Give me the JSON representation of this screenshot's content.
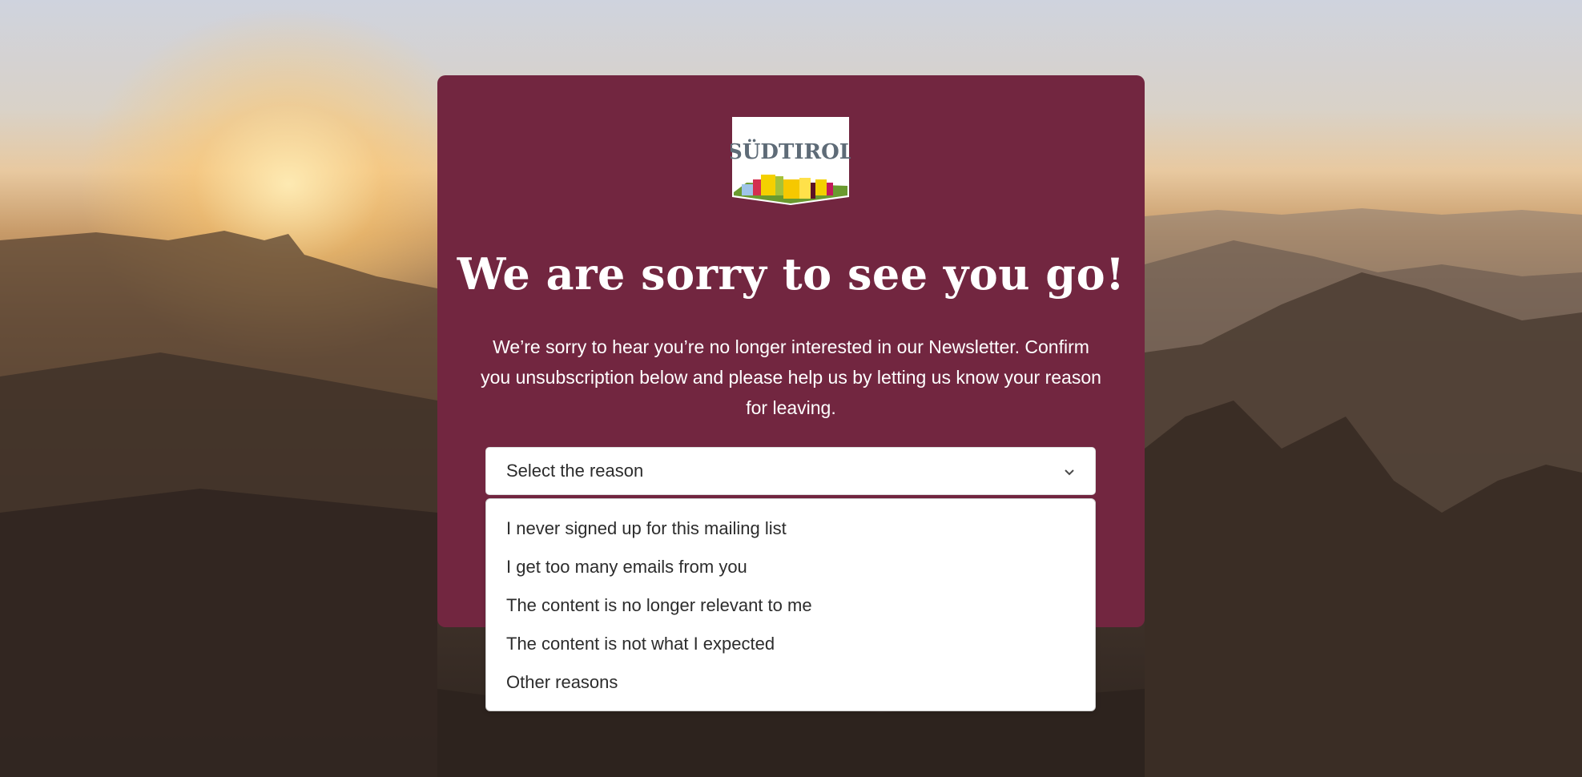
{
  "brand": {
    "logo_text": "SÜDTIROL"
  },
  "title": "We are sorry to see you go!",
  "intro": "We’re sorry to hear you’re no longer interested in our Newsletter. Confirm you unsubscription below and please help us by letting us know your reason for leaving.",
  "reason_select": {
    "placeholder": "Select the reason",
    "options": [
      "I never signed up for this mailing list",
      "I get too many emails from you",
      "The content is no longer relevant to me",
      "The content is not what I expected",
      "Other reasons"
    ]
  },
  "colors": {
    "card": "#722640",
    "title_text": "#ffffff",
    "select_bg": "#ffffff",
    "logo_text": "#5e6b77"
  },
  "icons": {
    "select_chevron": "chevron-down-icon"
  }
}
